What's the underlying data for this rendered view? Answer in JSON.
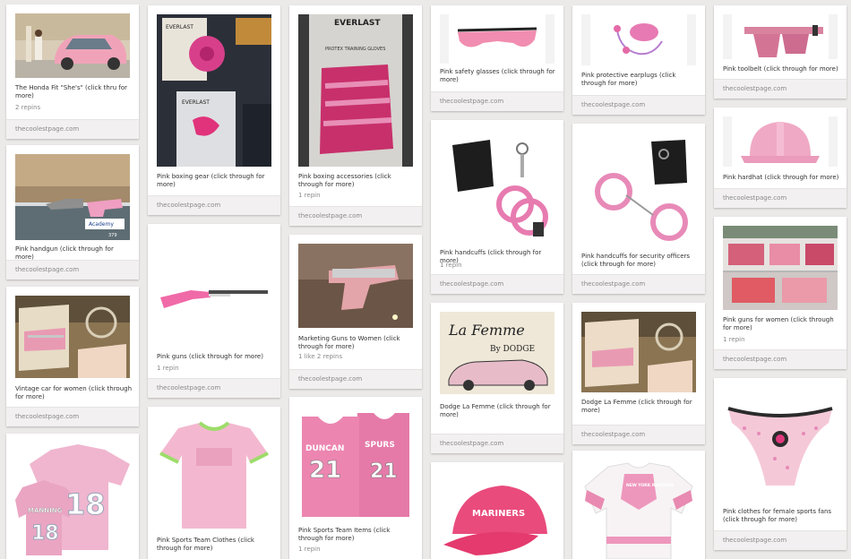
{
  "pins": [
    {
      "id": "honda",
      "caption": "The Honda Fit \"She's\" (click thru for more)",
      "meta": "2 repins",
      "source": "thecoolestpage.com"
    },
    {
      "id": "handgun",
      "caption": "Pink handgun (click through for more)",
      "meta": "",
      "source": "thecoolestpage.com"
    },
    {
      "id": "vintage-car",
      "caption": "Vintage car for women (click through for more)",
      "meta": "",
      "source": "thecoolestpage.com"
    },
    {
      "id": "jersey-18",
      "caption": "",
      "meta": "",
      "source": ""
    },
    {
      "id": "boxing-gear",
      "caption": "Pink boxing gear (click through for more)",
      "meta": "",
      "source": "thecoolestpage.com"
    },
    {
      "id": "guns",
      "caption": "Pink guns (click through for more)",
      "meta": "1 repin",
      "source": "thecoolestpage.com"
    },
    {
      "id": "sports-tee",
      "caption": "Pink Sports Team Clothes (click through for more)",
      "meta": "",
      "source": ""
    },
    {
      "id": "boxing-acc",
      "caption": "Pink boxing accessories (click through for more)",
      "meta": "1 repin",
      "source": "thecoolestpage.com"
    },
    {
      "id": "marketing-guns",
      "caption": "Marketing Guns to Women (click through for more)",
      "meta": "1 like   2 repins",
      "source": "thecoolestpage.com"
    },
    {
      "id": "spurs",
      "caption": "Pink Sports Team Items (click through for more)",
      "meta": "1 repin",
      "source": ""
    },
    {
      "id": "glasses",
      "caption": "Pink safety glasses (click through for more)",
      "meta": "",
      "source": "thecoolestpage.com"
    },
    {
      "id": "handcuffs",
      "caption": "Pink handcuffs (click through for more)",
      "meta": "1 repin",
      "source": "thecoolestpage.com"
    },
    {
      "id": "dodge",
      "caption": "Dodge La Femme (click through for more)",
      "meta": "",
      "source": "thecoolestpage.com"
    },
    {
      "id": "cap",
      "caption": "",
      "meta": "",
      "source": ""
    },
    {
      "id": "earplugs",
      "caption": "Pink protective earplugs (click through for more)",
      "meta": "",
      "source": "thecoolestpage.com"
    },
    {
      "id": "handcuffs-officers",
      "caption": "Pink handcuffs for security officers (click through for more)",
      "meta": "",
      "source": "thecoolestpage.com"
    },
    {
      "id": "dodge-2",
      "caption": "Dodge La Femme (click through for more)",
      "meta": "",
      "source": "thecoolestpage.com"
    },
    {
      "id": "hockey",
      "caption": "",
      "meta": "",
      "source": ""
    },
    {
      "id": "toolbelt",
      "caption": "Pink toolbelt (click through for more)",
      "meta": "",
      "source": "thecoolestpage.com"
    },
    {
      "id": "hardhat",
      "caption": "Pink hardhat (click through for more)",
      "meta": "",
      "source": "thecoolestpage.com"
    },
    {
      "id": "guns-women",
      "caption": "Pink guns for women (click through for more)",
      "meta": "1 repin",
      "source": "thecoolestpage.com"
    },
    {
      "id": "underwear",
      "caption": "Pink clothes for female sports fans (click through for more)",
      "meta": "",
      "source": "thecoolestpage.com"
    }
  ],
  "image_text": {
    "everlast": "EVERLAST",
    "training_gloves": "PROTEX TRAINING GLOVES",
    "academy": "Academy",
    "price": "379",
    "jersey_number": "18",
    "jersey_name": "MANNING",
    "spurs_number": "21",
    "spurs_name": "DUNCAN",
    "spurs_team": "SPURS",
    "la_femme": "La Femme",
    "by_dodge": "By DODGE",
    "mariners": "MARINERS",
    "ny_rangers": "NEW YORK RANGERS"
  },
  "colors": {
    "page_bg": "#ece9e9",
    "pink": "#e58bb6",
    "hot_pink": "#e0397d",
    "card_bg": "#ffffff",
    "footer_bg": "#f2f0f0"
  }
}
